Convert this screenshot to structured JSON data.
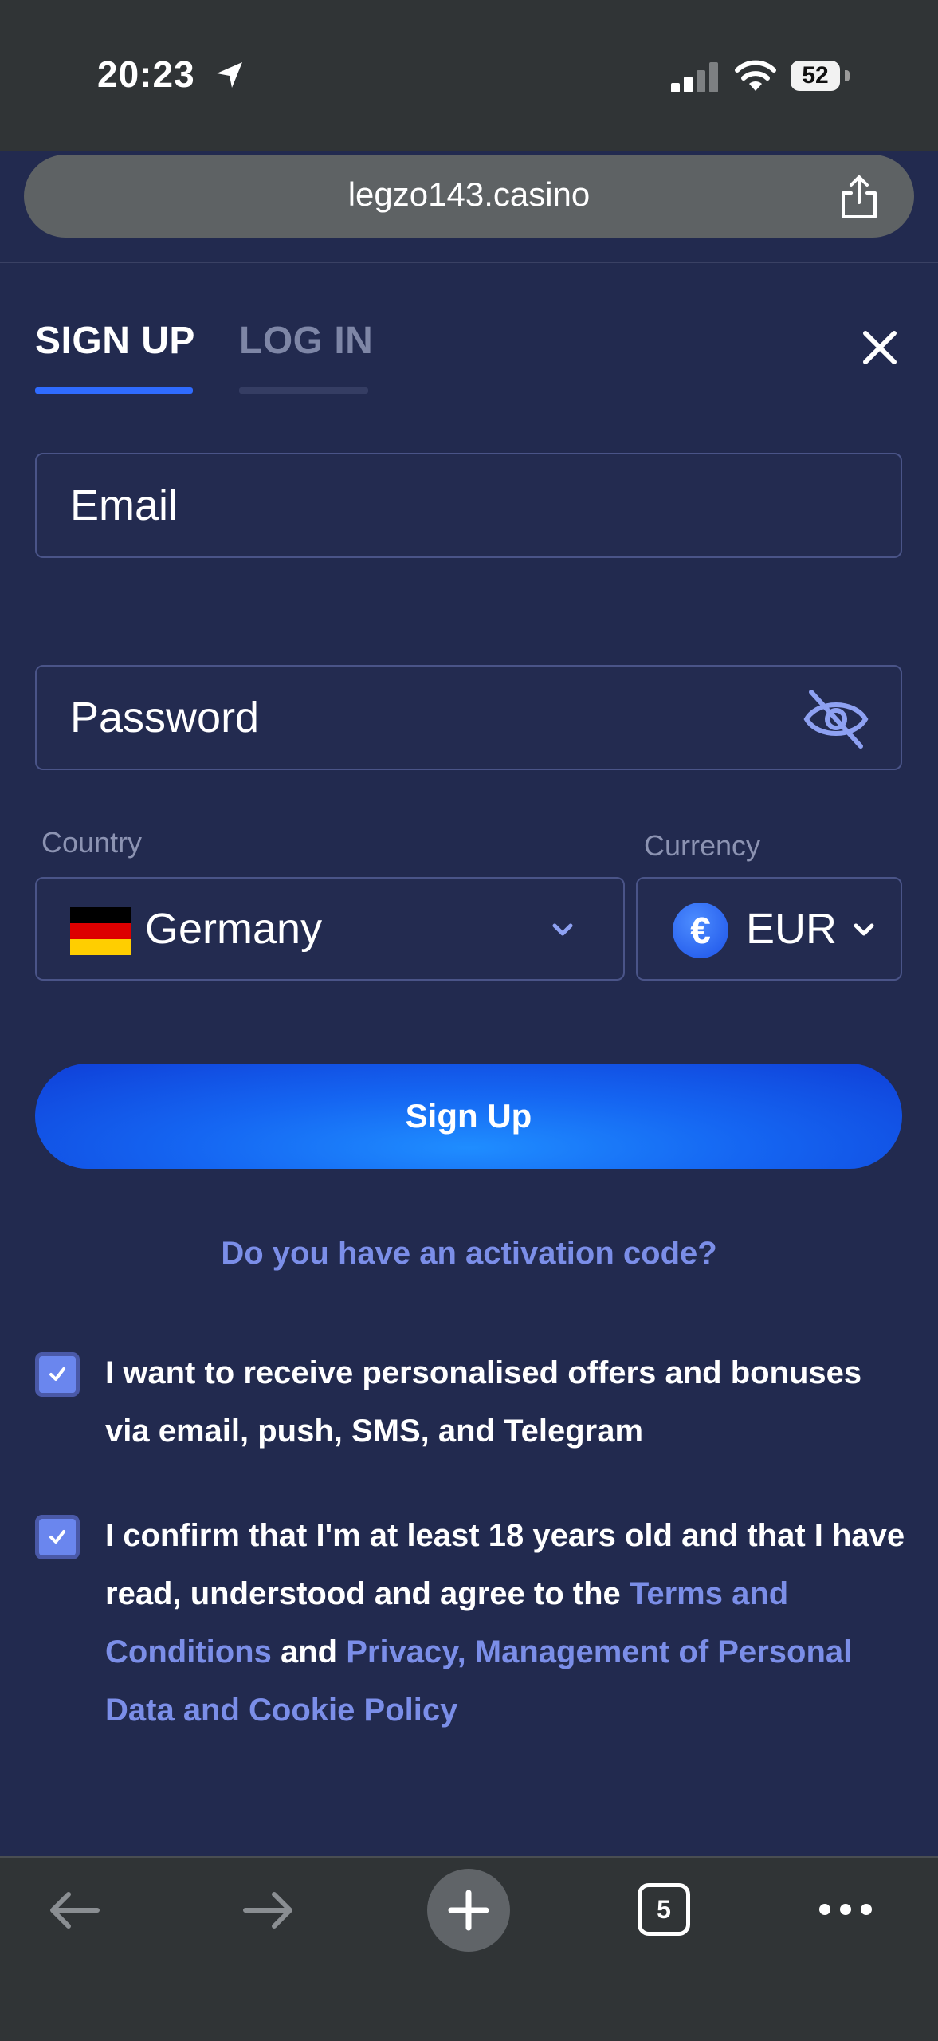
{
  "status_bar": {
    "time": "20:23",
    "battery": "52"
  },
  "browser": {
    "url": "legzo143.casino",
    "tab_count": "5"
  },
  "auth": {
    "tabs": [
      {
        "label": "SIGN UP",
        "active": true
      },
      {
        "label": "LOG IN",
        "active": false
      }
    ],
    "email_placeholder": "Email",
    "password_placeholder": "Password",
    "country_label": "Country",
    "country_value": "Germany",
    "currency_label": "Currency",
    "currency_value": "EUR",
    "currency_symbol": "€",
    "submit_label": "Sign Up",
    "activation_link": "Do you have an activation code?",
    "consent_offers": {
      "checked": true,
      "text": "I want to receive personalised offers and bonuses via email, push, SMS, and Telegram"
    },
    "consent_age": {
      "checked": true,
      "text_before": "I confirm that I'm at least 18 years old and that I have read, understood and agree to the ",
      "terms_link": "Terms and Conditions",
      "text_between": " and ",
      "privacy_link": "Privacy, Management of Personal Data and Cookie Policy"
    }
  },
  "colors": {
    "background": "#222a4f",
    "accent": "#2f6bff",
    "link": "#7b8ee8",
    "chrome": "#303436"
  },
  "icons": [
    "location-arrow-icon",
    "cellular-signal-icon",
    "wifi-icon",
    "battery-icon",
    "share-icon",
    "close-icon",
    "eye-off-icon",
    "germany-flag-icon",
    "chevron-down-icon",
    "euro-icon",
    "check-icon",
    "back-arrow-icon",
    "forward-arrow-icon",
    "plus-icon",
    "more-icon"
  ]
}
